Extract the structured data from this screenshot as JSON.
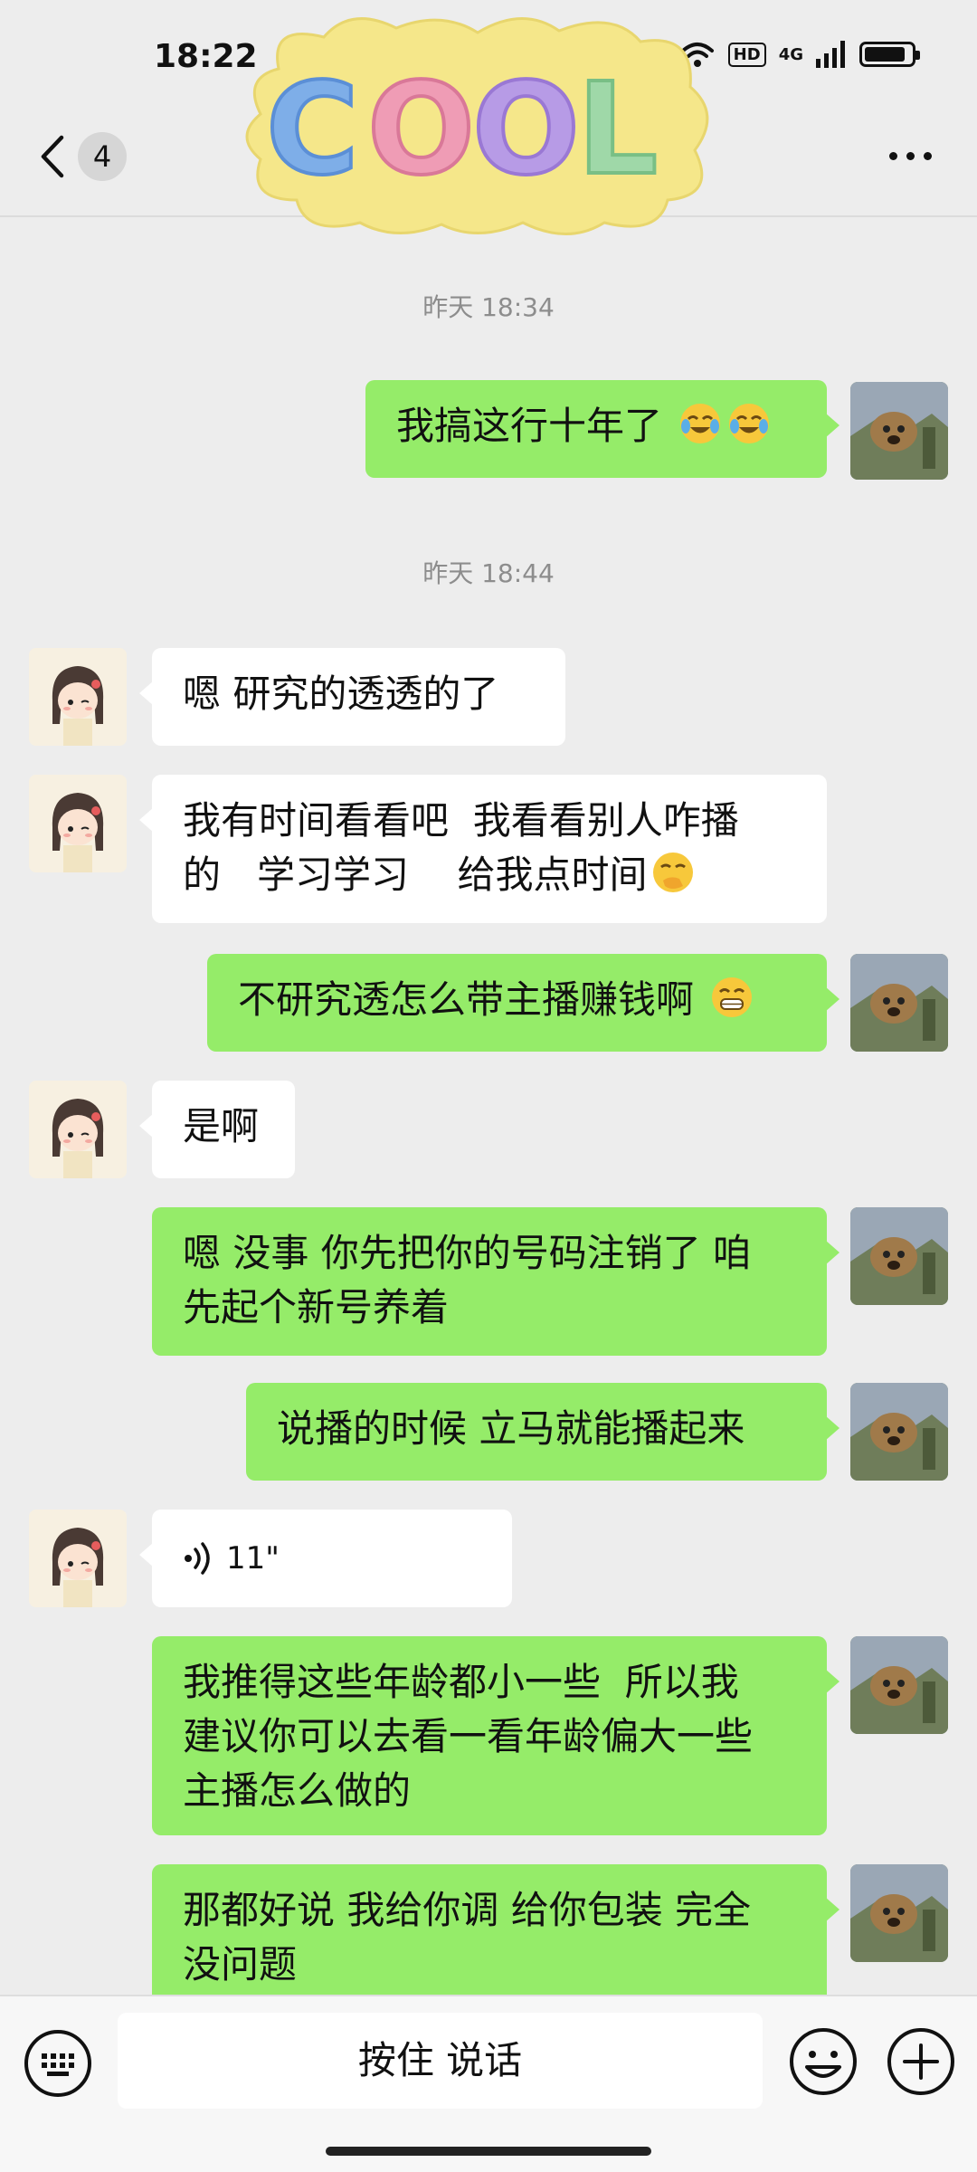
{
  "status_bar": {
    "time": "18:22",
    "hd": "HD",
    "network": "4G"
  },
  "header": {
    "unread_count": "4",
    "sticker_text": "COOL"
  },
  "messages": [
    {
      "type": "timestamp",
      "text": "昨天 18:34"
    },
    {
      "type": "out",
      "text": "我搞这行十年了",
      "emoji": [
        "tears-of-joy-emoji",
        "tears-of-joy-emoji"
      ]
    },
    {
      "type": "timestamp",
      "text": "昨天 18:44"
    },
    {
      "type": "in",
      "text": "嗯  研究的透透的了"
    },
    {
      "type": "in",
      "lines": [
        "我有时间看看吧  我看看别人咋播",
        "的   学习学习    给我点时间"
      ],
      "emoji": [
        "hand-over-mouth-emoji"
      ]
    },
    {
      "type": "out",
      "text": "不研究透怎么带主播赚钱啊",
      "emoji": [
        "grinning-emoji"
      ]
    },
    {
      "type": "in",
      "text": "是啊"
    },
    {
      "type": "out",
      "lines": [
        "嗯 没事 你先把你的号码注销了 咱",
        "先起个新号养着"
      ]
    },
    {
      "type": "out",
      "text": "说播的时候 立马就能播起来"
    },
    {
      "type": "in",
      "voice_duration": "11\""
    },
    {
      "type": "out",
      "lines": [
        "我推得这些年龄都小一些  所以我",
        "建议你可以去看一看年龄偏大一些",
        "主播怎么做的"
      ]
    },
    {
      "type": "out",
      "lines": [
        "那都好说 我给你调 给你包装 完全",
        "没问题"
      ]
    }
  ],
  "input_bar": {
    "talk_label": "按住 说话"
  },
  "colors": {
    "outgoing_bubble": "#95ec69",
    "incoming_bubble": "#ffffff",
    "background": "#ededed"
  }
}
